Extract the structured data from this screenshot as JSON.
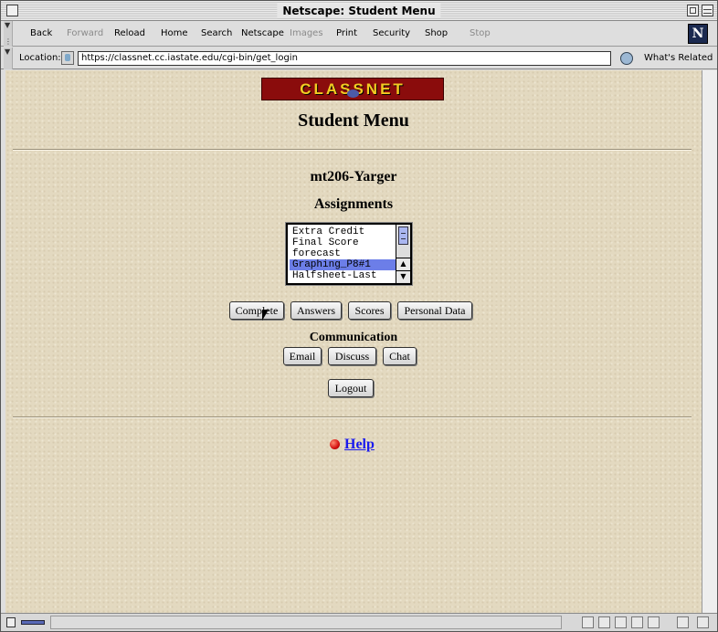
{
  "window": {
    "title": "Netscape: Student Menu"
  },
  "toolbar": {
    "back": "Back",
    "forward": "Forward",
    "reload": "Reload",
    "home": "Home",
    "search": "Search",
    "netscape": "Netscape",
    "images": "Images",
    "print": "Print",
    "security": "Security",
    "shop": "Shop",
    "stop": "Stop",
    "logo": "N"
  },
  "location": {
    "label": "Location:",
    "url": "https://classnet.cc.iastate.edu/cgi-bin/get_login",
    "related": "What's Related"
  },
  "page": {
    "banner": "CLASSNET",
    "title": "Student Menu",
    "course": "mt206-Yarger",
    "assignments_heading": "Assignments",
    "assignments": [
      {
        "label": "Extra Credit",
        "selected": false
      },
      {
        "label": "Final Score",
        "selected": false
      },
      {
        "label": "forecast",
        "selected": false
      },
      {
        "label": "Graphing_P8#1",
        "selected": true
      },
      {
        "label": "Halfsheet-Last",
        "selected": false
      }
    ],
    "buttons": {
      "complete": "Complete",
      "answers": "Answers",
      "scores": "Scores",
      "personal_data": "Personal Data"
    },
    "communication_heading": "Communication",
    "comm_buttons": {
      "email": "Email",
      "discuss": "Discuss",
      "chat": "Chat"
    },
    "logout": "Logout",
    "help": "Help"
  },
  "colors": {
    "background": "#e3d9c0",
    "link": "#1a1aee",
    "selection": "#6c7ee8",
    "banner": "#8a0c0c"
  }
}
